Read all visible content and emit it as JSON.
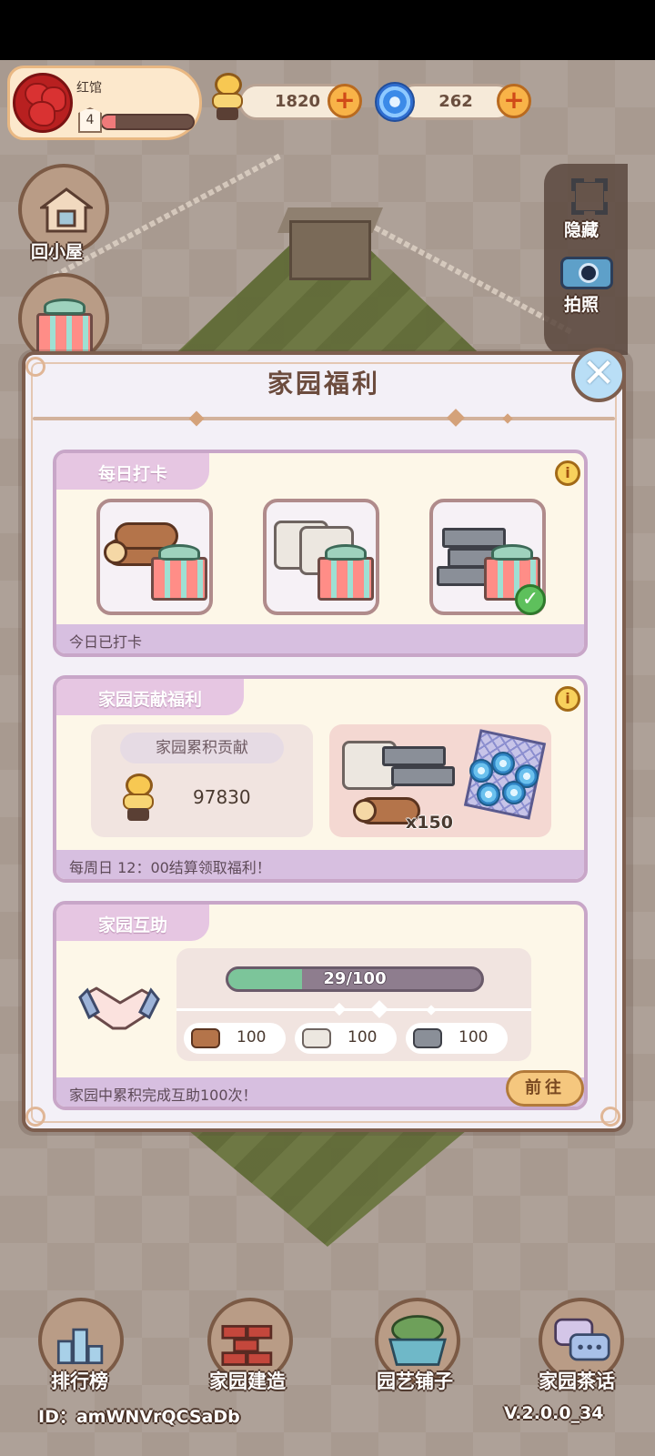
{
  "profile": {
    "name": "红馆",
    "level": "4",
    "level_progress": 0.15
  },
  "currencies": {
    "snail_coins": "1820",
    "swirl_gems": "262"
  },
  "side_buttons": {
    "home_label": "回小屋",
    "hide_label": "隐藏",
    "photo_label": "拍照"
  },
  "modal": {
    "title": "家园福利",
    "close_symbol": "✕",
    "info_symbol": "i",
    "daily": {
      "tab": "每日打卡",
      "footer": "今日已打卡",
      "rewards": [
        {
          "item": "wood-gift",
          "claimed": false
        },
        {
          "item": "cement-gift",
          "claimed": false
        },
        {
          "item": "steel-gift",
          "claimed": true
        }
      ],
      "check_symbol": "✓"
    },
    "contribution": {
      "tab": "家园贡献福利",
      "label": "家园累积贡献",
      "value": "97830",
      "reward_qty": "x150",
      "footer": "每周日 12：00结算领取福利！"
    },
    "mutual_help": {
      "tab": "家园互助",
      "progress_text": "29/100",
      "progress": 0.29,
      "materials": [
        {
          "icon": "wood-icon",
          "amount": "100"
        },
        {
          "icon": "cement-icon",
          "amount": "100"
        },
        {
          "icon": "steel-icon",
          "amount": "100"
        }
      ],
      "footer": "家园中累积完成互助100次！",
      "go_label": "前往"
    }
  },
  "bottom_nav": [
    {
      "label": "排行榜",
      "icon": "leaderboard-icon"
    },
    {
      "label": "家园建造",
      "icon": "bricks-icon"
    },
    {
      "label": "园艺铺子",
      "icon": "planter-icon"
    },
    {
      "label": "家园茶话",
      "icon": "chat-icon"
    }
  ],
  "footer": {
    "id_text": "ID：amWNVrQCSaDb",
    "version": "V.2.0.0_34"
  },
  "colors": {
    "accent": "#f8b348",
    "card_border": "#c8a6c8",
    "modal_border": "#7d5e4e"
  }
}
